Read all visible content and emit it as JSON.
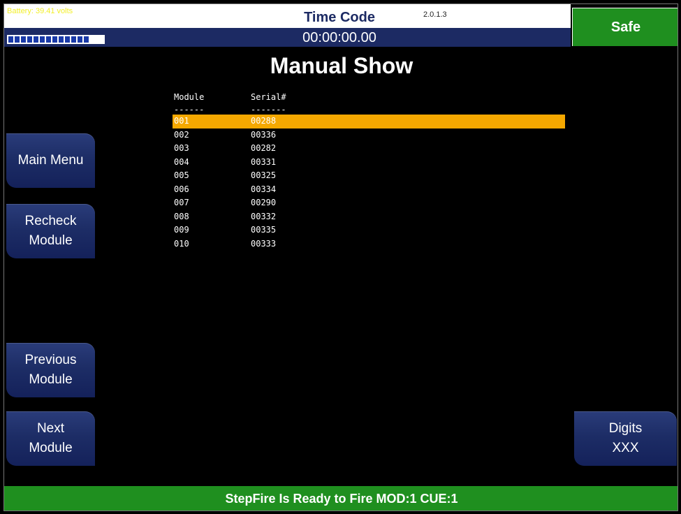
{
  "header": {
    "battery_label": "Battery: 39.41 volts",
    "battery_level": 0.85,
    "timecode_title": "Time Code",
    "version": "2.0.1.3",
    "timecode_value": "00:00:00.00",
    "safe_label": "Safe"
  },
  "page_title": "Manual Show",
  "table": {
    "col_module": "Module",
    "col_serial": "Serial#",
    "dash_module": "------",
    "dash_serial": "-------",
    "rows": [
      {
        "module": "001",
        "serial": "00288",
        "selected": true
      },
      {
        "module": "002",
        "serial": "00336"
      },
      {
        "module": "003",
        "serial": "00282"
      },
      {
        "module": "004",
        "serial": "00331"
      },
      {
        "module": "005",
        "serial": "00325"
      },
      {
        "module": "006",
        "serial": "00334"
      },
      {
        "module": "007",
        "serial": "00290"
      },
      {
        "module": "008",
        "serial": "00332"
      },
      {
        "module": "009",
        "serial": "00335"
      },
      {
        "module": "010",
        "serial": "00333"
      }
    ]
  },
  "buttons": {
    "main_menu": "Main Menu",
    "recheck_line1": "Recheck",
    "recheck_line2": "Module",
    "prev_line1": "Previous",
    "prev_line2": "Module",
    "next_line1": "Next",
    "next_line2": "Module",
    "digits_line1": "Digits",
    "digits_line2": "XXX"
  },
  "status": "StepFire Is Ready to Fire MOD:1 CUE:1",
  "colors": {
    "selected_row": "#f5a800",
    "status_green": "#1f8f1f",
    "header_navy": "#1c2a63",
    "battery_text": "#f2ef2a"
  }
}
